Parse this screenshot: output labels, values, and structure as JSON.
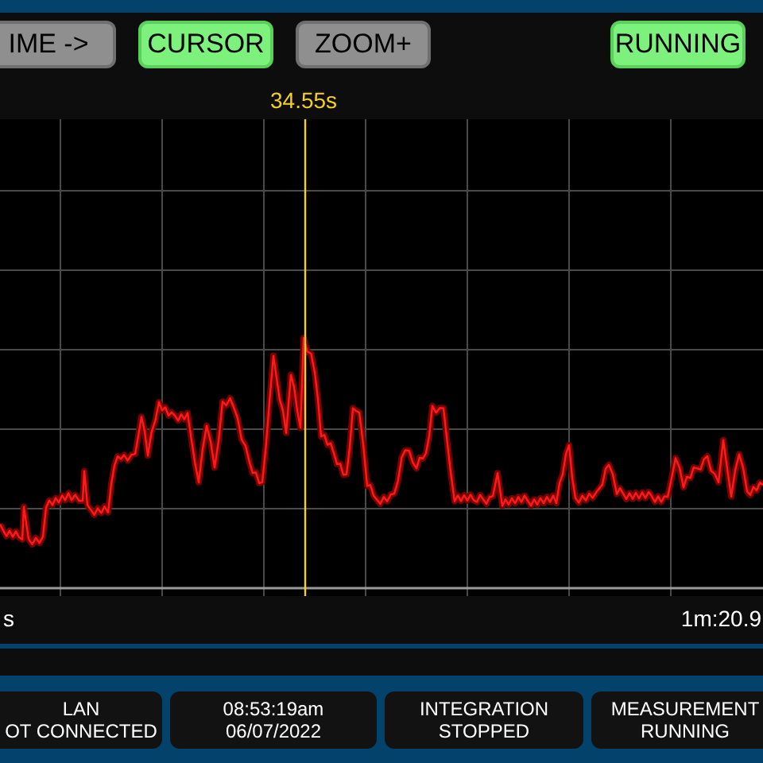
{
  "toolbar": {
    "buttons": [
      {
        "label": "IME ->",
        "selected": false
      },
      {
        "label": "CURSOR",
        "selected": true
      },
      {
        "label": "ZOOM+",
        "selected": false
      }
    ],
    "status_button": {
      "label": "RUNNING",
      "selected": true
    }
  },
  "cursor": {
    "label": "34.55s"
  },
  "axis": {
    "start": "s",
    "end": "1m:20.9"
  },
  "status_bar": [
    {
      "line1": "LAN",
      "line2": "OT CONNECTED"
    },
    {
      "line1": "08:53:19am",
      "line2": "06/07/2022"
    },
    {
      "line1": "INTEGRATION",
      "line2": "STOPPED"
    },
    {
      "line1": "MEASUREMENT",
      "line2": "RUNNING"
    }
  ]
}
